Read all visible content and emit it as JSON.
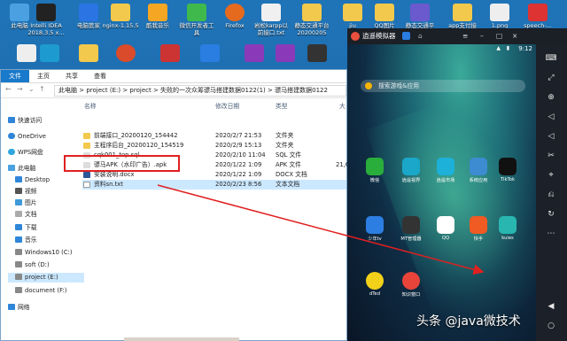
{
  "desktop": {
    "row1": [
      "此电脑",
      "Intelli IDEA 2018.3.5 x...",
      "电脑管家",
      "nginx-1.15.5",
      "酷我音乐",
      "微信开发者工具",
      "Firefox",
      "岩松karpp以前接口.txt",
      "静态交通平台20200205",
      "jiu",
      "QQ图片",
      "静态交通平",
      "app支付接",
      "1.png",
      "speech-..."
    ]
  },
  "explorer": {
    "ribbon": [
      "文件",
      "主页",
      "共享",
      "查看"
    ],
    "address": [
      "此电脑",
      "project (E:)",
      "project",
      "失败的一次众筹骠马搭建数据0122(1)",
      "骠马搭建数据0122"
    ],
    "columns": {
      "name": "名称",
      "date": "修改日期",
      "type": "类型",
      "size": "大"
    },
    "files": [
      {
        "name": "前端接口_20200120_154442",
        "date": "2020/2/7 21:53",
        "type": "文件夹",
        "size": ""
      },
      {
        "name": "主程序后台_20200120_154519",
        "date": "2020/2/9 15:13",
        "type": "文件夹",
        "size": ""
      },
      {
        "name": "cqk001_top.sql",
        "date": "2020/2/10 11:04",
        "type": "SQL 文件",
        "size": ""
      },
      {
        "name": "骠马APK（水印广告）.apk",
        "date": "2020/1/22 1:09",
        "type": "APK 文件",
        "size": "21,6"
      },
      {
        "name": "安装说明.docx",
        "date": "2020/1/22 1:09",
        "type": "DOCX 文档",
        "size": ""
      },
      {
        "name": "资料sn.txt",
        "date": "2020/2/23 8:56",
        "type": "文本文档",
        "size": ""
      }
    ],
    "sidebar": [
      {
        "label": "快速访问"
      },
      {
        "label": "OneDrive"
      },
      {
        "label": "WPS网盘"
      },
      {
        "label": "此电脑"
      },
      {
        "label": "Desktop"
      },
      {
        "label": "视频"
      },
      {
        "label": "图片"
      },
      {
        "label": "文档"
      },
      {
        "label": "下载"
      },
      {
        "label": "音乐"
      },
      {
        "label": "Windows10 (C:)"
      },
      {
        "label": "soft (D:)"
      },
      {
        "label": "project (E:)"
      },
      {
        "label": "document (F:)"
      },
      {
        "label": "网络"
      }
    ]
  },
  "emulator": {
    "title": "逍遥模拟器",
    "time": "9:12",
    "search_placeholder": "搜索游戏&应用",
    "apps_row1": [
      "微信",
      "逍遥视界",
      "逍遥市场",
      "系统应用",
      "TikTok"
    ],
    "apps_row2": [
      "少年tv",
      "MT管理器",
      "QQ",
      "快手",
      "kuies"
    ],
    "apps_row3": [
      "dTed",
      "知识窗口"
    ]
  },
  "watermark": "头条 @java微技术",
  "colors": {
    "accent": "#1979ca",
    "highlight": "#e02020",
    "selection": "#cce8ff"
  }
}
